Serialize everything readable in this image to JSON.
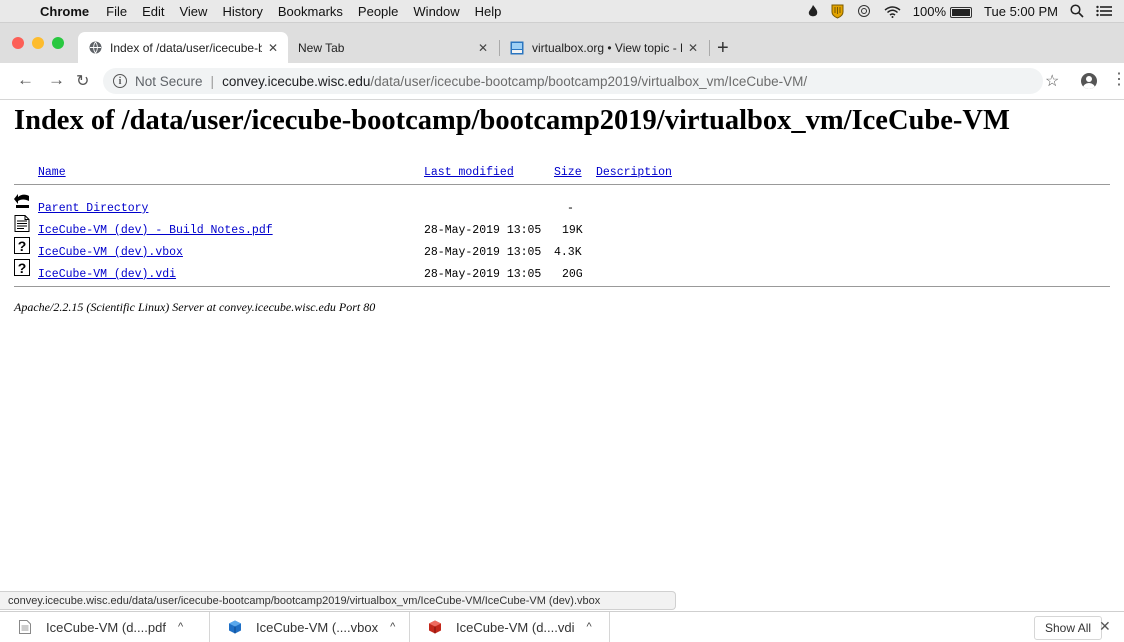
{
  "menubar": {
    "app": "Chrome",
    "items": [
      "File",
      "Edit",
      "View",
      "History",
      "Bookmarks",
      "People",
      "Window",
      "Help"
    ],
    "battery": "100%",
    "clock": "Tue 5:00 PM"
  },
  "tabs": [
    {
      "title": "Index of /data/user/icecube-bo",
      "active": true,
      "favicon": "globe-icon"
    },
    {
      "title": "New Tab",
      "active": false
    },
    {
      "title": "virtualbox.org • View topic - Fo",
      "active": false,
      "favicon": "virtualbox-forum-icon"
    }
  ],
  "address": {
    "security": "Not Secure",
    "host": "convey.icecube.wisc.edu",
    "path": "/data/user/icecube-bootcamp/bootcamp2019/virtualbox_vm/IceCube-VM/"
  },
  "page": {
    "heading": "Index of /data/user/icecube-bootcamp/bootcamp2019/virtualbox_vm/IceCube-VM",
    "columns": {
      "name": "Name",
      "modified": "Last modified",
      "size": "Size",
      "description": "Description"
    },
    "parent": {
      "name": "Parent Directory",
      "size": "-"
    },
    "files": [
      {
        "name": "IceCube-VM (dev) - Build Notes.pdf",
        "modified": "28-May-2019 13:05",
        "size": "19K",
        "icon": "document-icon"
      },
      {
        "name": "IceCube-VM (dev).vbox",
        "modified": "28-May-2019 13:05",
        "size": "4.3K",
        "icon": "unknown-file-icon"
      },
      {
        "name": "IceCube-VM (dev).vdi",
        "modified": "28-May-2019 13:05",
        "size": "20G",
        "icon": "unknown-file-icon"
      }
    ],
    "footer": "Apache/2.2.15 (Scientific Linux) Server at convey.icecube.wisc.edu Port 80"
  },
  "status_url": "convey.icecube.wisc.edu/data/user/icecube-bootcamp/bootcamp2019/virtualbox_vm/IceCube-VM/IceCube-VM (dev).vbox",
  "downloads": [
    {
      "label": "IceCube-VM (d....pdf",
      "icon": "pdf-file-icon"
    },
    {
      "label": "IceCube-VM (....vbox",
      "icon": "virtualbox-icon"
    },
    {
      "label": "IceCube-VM (d....vdi",
      "icon": "vdi-disk-icon"
    }
  ],
  "shelf": {
    "show_all": "Show All"
  },
  "colors": {
    "link": "#0000cc",
    "tabstrip": "#dedede",
    "omnibox": "#f1f3f4"
  }
}
